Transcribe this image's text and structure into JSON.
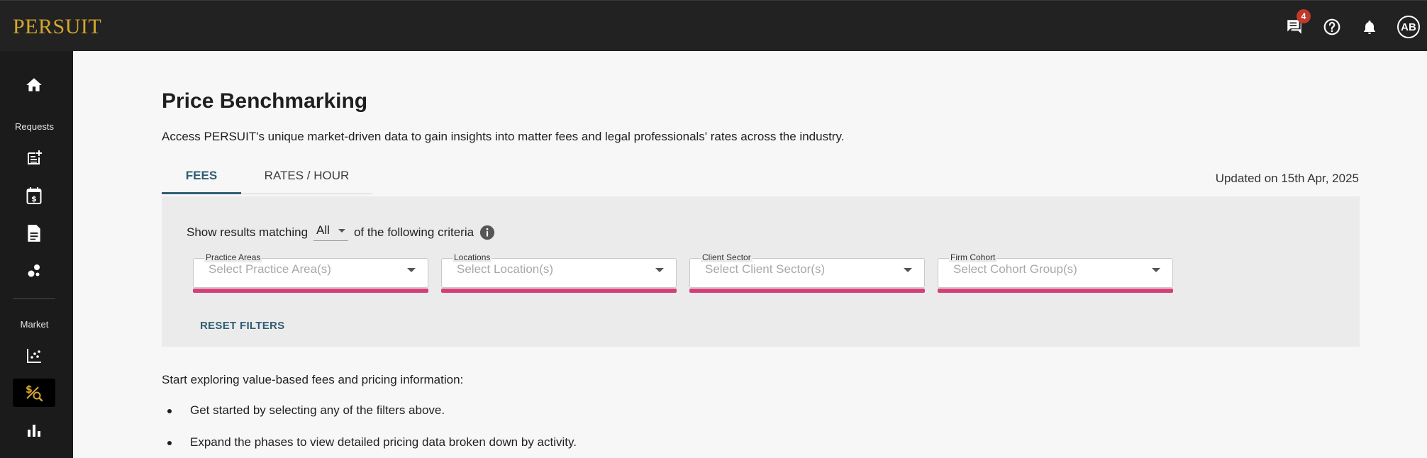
{
  "app": {
    "logo": "PERSUIT"
  },
  "topbar": {
    "messages_icon": "chat-icon",
    "messages_badge": "4",
    "help_icon": "help-circle-icon",
    "notifications_icon": "bell-icon",
    "avatar_initials": "AB"
  },
  "sidebar": {
    "section_requests": "Requests",
    "section_market": "Market",
    "items": [
      {
        "name": "home",
        "icon": "home-icon"
      },
      {
        "name": "new-request",
        "icon": "note-add-icon"
      },
      {
        "name": "calendar-fees",
        "icon": "calendar-dollar-icon"
      },
      {
        "name": "documents",
        "icon": "document-icon"
      },
      {
        "name": "bubbles",
        "icon": "bubble-chart-icon"
      },
      {
        "name": "scatter",
        "icon": "scatter-plot-icon"
      },
      {
        "name": "price-benchmarking",
        "icon": "price-search-icon",
        "active": true
      },
      {
        "name": "bar-chart",
        "icon": "bar-chart-icon"
      }
    ]
  },
  "page": {
    "title": "Price Benchmarking",
    "subtitle": "Access PERSUIT's unique market-driven data to gain insights into matter fees and legal professionals' rates across the industry.",
    "updated": "Updated on 15th Apr, 2025"
  },
  "tabs": [
    {
      "label": "FEES",
      "active": true
    },
    {
      "label": "RATES / HOUR",
      "active": false
    }
  ],
  "filters": {
    "criteria_prefix": "Show results matching",
    "match_value": "All",
    "criteria_suffix": "of the following criteria",
    "fields": [
      {
        "label": "Practice Areas",
        "placeholder": "Select Practice Area(s)"
      },
      {
        "label": "Locations",
        "placeholder": "Select Location(s)"
      },
      {
        "label": "Client Sector",
        "placeholder": "Select Client Sector(s)"
      },
      {
        "label": "Firm Cohort",
        "placeholder": "Select Cohort Group(s)"
      }
    ],
    "reset_label": "RESET FILTERS",
    "accent_color": "#d43f77"
  },
  "explore": {
    "intro": "Start exploring value-based fees and pricing information:",
    "bullets": [
      "Get started by selecting any of the filters above.",
      "Expand the phases to view detailed pricing data broken down by activity."
    ]
  }
}
